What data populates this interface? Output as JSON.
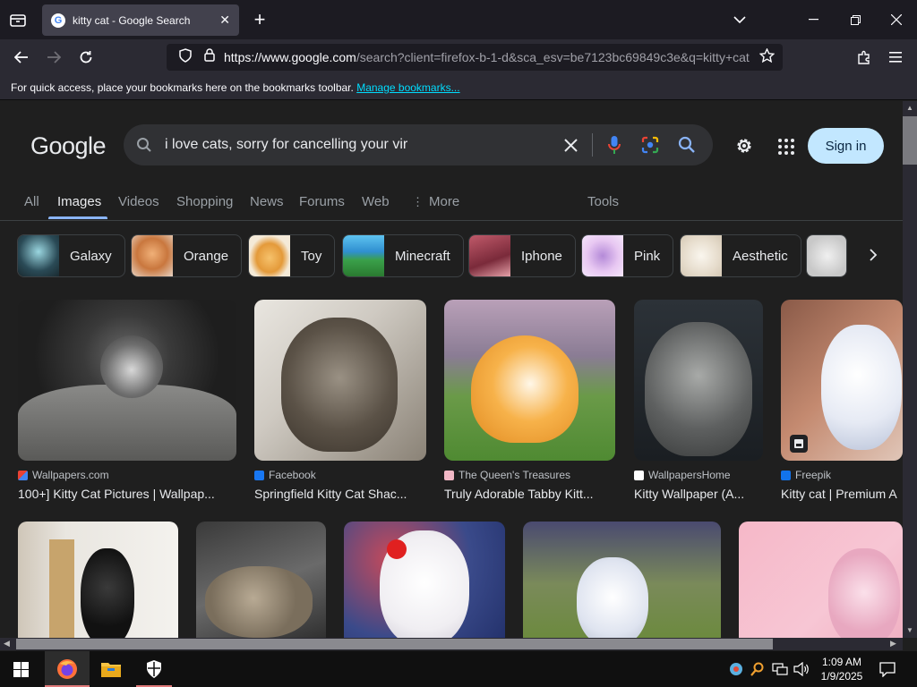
{
  "browser": {
    "tab_title": "kitty cat - Google Search",
    "url_host": "https://www.google.com",
    "url_path": "/search?client=firefox-b-1-d&sca_esv=be7123bc69849c3e&q=kitty+cat",
    "bookmarks_text": "For quick access, place your bookmarks here on the bookmarks toolbar.",
    "bookmarks_link": "Manage bookmarks..."
  },
  "google": {
    "logo": "Google",
    "search_query": "i love cats, sorry for cancelling your vir",
    "signin_label": "Sign in",
    "tabs": [
      "All",
      "Images",
      "Videos",
      "Shopping",
      "News",
      "Forums",
      "Web",
      "More",
      "Tools"
    ],
    "active_tab": "Images"
  },
  "chips": [
    {
      "label": "Galaxy",
      "color": "#3a5a6a"
    },
    {
      "label": "Orange",
      "color": "#c98a55"
    },
    {
      "label": "Toy",
      "color": "#e8b25a"
    },
    {
      "label": "Minecraft",
      "color": "#3ba7d9"
    },
    {
      "label": "Iphone",
      "color": "#a04050"
    },
    {
      "label": "Pink",
      "color": "#d7a8e8"
    },
    {
      "label": "Aesthetic",
      "color": "#e8e2d8"
    }
  ],
  "results_row1": [
    {
      "source": "Wallpapers.com",
      "title": "100+] Kitty Cat Pictures | Wallpap...",
      "fav": "#e94235"
    },
    {
      "source": "Facebook",
      "title": "Springfield Kitty Cat Shac...",
      "fav": "#1877f2"
    },
    {
      "source": "The Queen's Treasures",
      "title": "Truly Adorable Tabby Kitt...",
      "fav": "#f2b8c6"
    },
    {
      "source": "WallpapersHome",
      "title": "Kitty Wallpaper (A...",
      "fav": "#ffffff"
    },
    {
      "source": "Freepik",
      "title": "Kitty cat | Premium A",
      "fav": "#1273eb"
    }
  ],
  "taskbar": {
    "time": "1:09 AM",
    "date": "1/9/2025"
  }
}
